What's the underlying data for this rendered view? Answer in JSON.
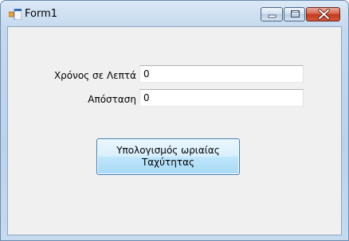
{
  "window": {
    "title": "Form1",
    "controls": {
      "minimize": "minimize",
      "maximize": "maximize",
      "close": "close"
    }
  },
  "form": {
    "time_label": "Χρόνος σε Λεπτά",
    "time_value": "0",
    "distance_label": "Απόσταση",
    "distance_value": "0",
    "calc_button": "Υπολογισμός ωριαίας Ταχύτητας"
  },
  "colors": {
    "titlebar": "#c4d8ee",
    "client_bg": "#f0f0f0",
    "button_border": "#3c7fb1",
    "close_button": "#c03a1f"
  },
  "icons": [
    "app-icon",
    "minimize-icon",
    "maximize-icon",
    "close-icon"
  ]
}
